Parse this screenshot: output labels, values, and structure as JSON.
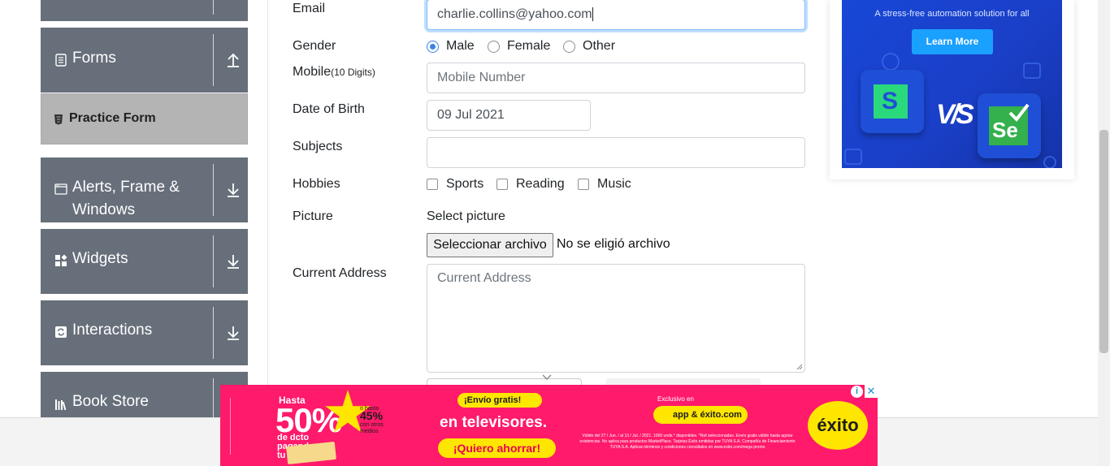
{
  "sidebar": {
    "groups": [
      {
        "label": "Forms",
        "icon": "list-icon",
        "arrow": "arrow-up-icon"
      },
      {
        "label": "Alerts, Frame &",
        "label2": "Windows",
        "icon": "window-icon",
        "arrow": "arrow-down-icon"
      },
      {
        "label": "Widgets",
        "icon": "widgets-icon",
        "arrow": "arrow-down-icon"
      },
      {
        "label": "Interactions",
        "icon": "sync-icon",
        "arrow": "arrow-down-icon"
      },
      {
        "label": "Book Store",
        "icon": "books-icon",
        "arrow": "arrow-down-icon"
      }
    ],
    "active_item": {
      "label": "Practice Form",
      "icon": "html-icon"
    }
  },
  "form": {
    "email": {
      "label": "Email",
      "value": "charlie.collins@yahoo.com"
    },
    "gender": {
      "label": "Gender",
      "options": [
        "Male",
        "Female",
        "Other"
      ],
      "selected": "Male"
    },
    "mobile": {
      "label": "Mobile",
      "hint": "(10 Digits)",
      "placeholder": "Mobile Number"
    },
    "dob": {
      "label": "Date of Birth",
      "value": "09 Jul 2021"
    },
    "subjects": {
      "label": "Subjects",
      "value": ""
    },
    "hobbies": {
      "label": "Hobbies",
      "options": [
        "Sports",
        "Reading",
        "Music"
      ]
    },
    "picture": {
      "label": "Picture",
      "select_text": "Select picture",
      "button": "Seleccionar archivo",
      "status": "No se eligió archivo"
    },
    "address": {
      "label": "Current Address",
      "placeholder": "Current Address"
    }
  },
  "ad_right": {
    "tagline": "A stress-free automation solution for all",
    "button": "Learn More",
    "vs_text": "V/S"
  },
  "banner": {
    "upto": "Hasta",
    "discount": "50%",
    "star_value": "45%",
    "mini_note": "o hasta",
    "mini_note2": "con otros medios",
    "dcto": "de dcto pagando con tu",
    "envio": "¡Envío gratis!",
    "tv": "en televisores.",
    "cta": "¡Quiero ahorrar!",
    "exclusive": "Exclusivo en",
    "app": "app & éxito.com",
    "fine_print": "Válido del 27 / Jun. / al 13 / Jul. / 2021. 1000 unds.* disponibles. *Ref seleccionadas. Envío gratis válido hasta agotar existencias. No aplica para productos MarketPlace. Tarjetas Éxito emitidas por TUYA S.A. Compañía de Financiamiento TUYA S.A. Aplican términos y condiciones consúltalos en www.exito.com/mega promo",
    "logo": "éxito"
  },
  "colors": {
    "sidebar_bg": "#666f7a",
    "active_item_bg": "#b4b4b4",
    "radio_accent": "#3b82e6",
    "banner_bg": "#ff1a6b",
    "banner_accent": "#ffe600",
    "ad_bg": "#1847d6"
  }
}
